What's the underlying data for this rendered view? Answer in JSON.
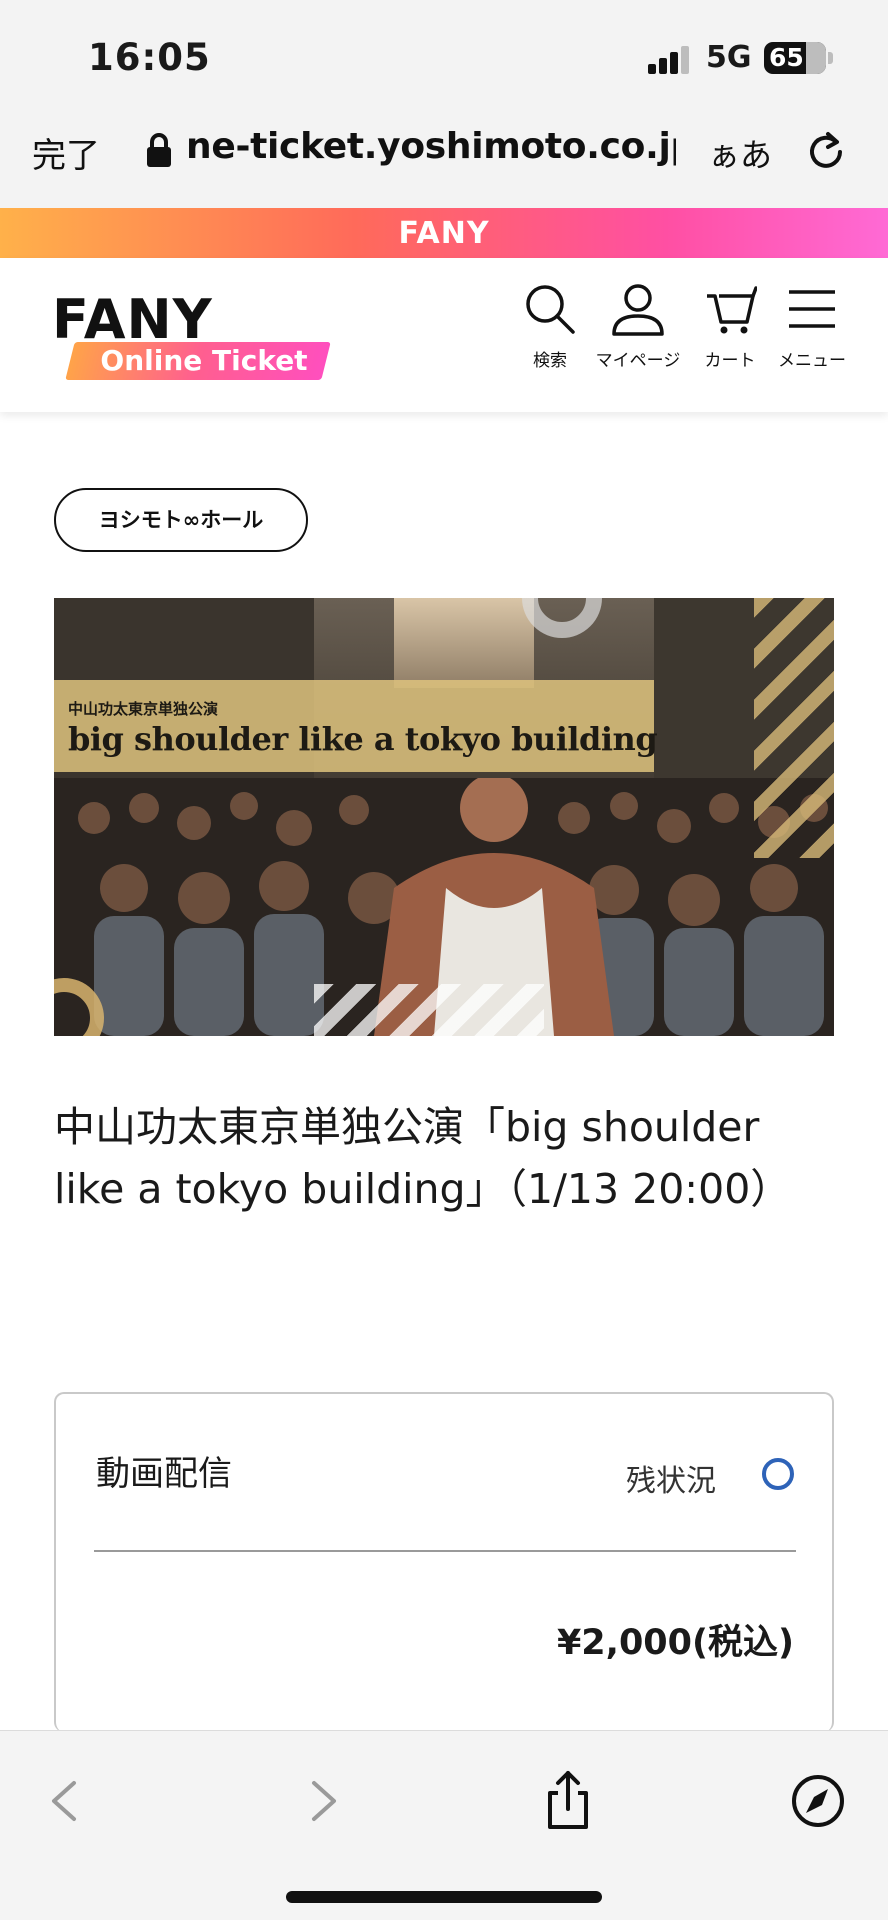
{
  "status_bar": {
    "time": "16:05",
    "network": "5G",
    "battery": "65"
  },
  "browser": {
    "done_label": "完了",
    "url": "ne-ticket.yoshimoto.co.jp",
    "text_size_label": "ぁあ"
  },
  "brand_strip": {
    "text": "FANY"
  },
  "header": {
    "logo_main": "FANY",
    "logo_sub": "Online Ticket",
    "nav": [
      {
        "label": "検索",
        "icon": "search-icon"
      },
      {
        "label": "マイページ",
        "icon": "user-icon"
      },
      {
        "label": "カート",
        "icon": "cart-icon"
      },
      {
        "label": "メニュー",
        "icon": "menu-icon"
      }
    ]
  },
  "event": {
    "venue": "ヨシモト∞ホール",
    "banner_subtitle": "中山功太東京単独公演",
    "banner_title": "big shoulder like a tokyo building",
    "title": "中山功太東京単独公演「big shoulder like a tokyo building」（1/13 20:00）"
  },
  "ticket": {
    "type": "動画配信",
    "availability_label": "残状況",
    "availability_mark": "○",
    "price": "¥2,000(税込)"
  },
  "colors": {
    "accent_blue": "#2e63b8",
    "brand_gradient_start": "#ffb14a",
    "brand_gradient_end": "#ff6ad5"
  }
}
